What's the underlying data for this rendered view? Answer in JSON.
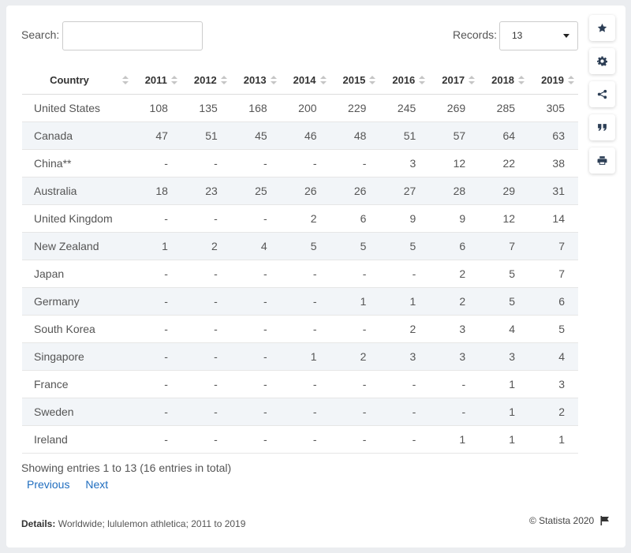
{
  "search": {
    "label": "Search:",
    "value": ""
  },
  "records": {
    "label": "Records:",
    "value": "13"
  },
  "toolbar": [
    {
      "icon": "star-icon"
    },
    {
      "icon": "gear-icon"
    },
    {
      "icon": "share-icon"
    },
    {
      "icon": "quote-icon"
    },
    {
      "icon": "print-icon"
    }
  ],
  "chart_data": {
    "type": "table",
    "columns": [
      "Country",
      "2011",
      "2012",
      "2013",
      "2014",
      "2015",
      "2016",
      "2017",
      "2018",
      "2019"
    ],
    "rows": [
      [
        "United States",
        "108",
        "135",
        "168",
        "200",
        "229",
        "245",
        "269",
        "285",
        "305"
      ],
      [
        "Canada",
        "47",
        "51",
        "45",
        "46",
        "48",
        "51",
        "57",
        "64",
        "63"
      ],
      [
        "China**",
        "-",
        "-",
        "-",
        "-",
        "-",
        "3",
        "12",
        "22",
        "38"
      ],
      [
        "Australia",
        "18",
        "23",
        "25",
        "26",
        "26",
        "27",
        "28",
        "29",
        "31"
      ],
      [
        "United Kingdom",
        "-",
        "-",
        "-",
        "2",
        "6",
        "9",
        "9",
        "12",
        "14"
      ],
      [
        "New Zealand",
        "1",
        "2",
        "4",
        "5",
        "5",
        "5",
        "6",
        "7",
        "7"
      ],
      [
        "Japan",
        "-",
        "-",
        "-",
        "-",
        "-",
        "-",
        "2",
        "5",
        "7"
      ],
      [
        "Germany",
        "-",
        "-",
        "-",
        "-",
        "1",
        "1",
        "2",
        "5",
        "6"
      ],
      [
        "South Korea",
        "-",
        "-",
        "-",
        "-",
        "-",
        "2",
        "3",
        "4",
        "5"
      ],
      [
        "Singapore",
        "-",
        "-",
        "-",
        "1",
        "2",
        "3",
        "3",
        "3",
        "4"
      ],
      [
        "France",
        "-",
        "-",
        "-",
        "-",
        "-",
        "-",
        "-",
        "1",
        "3"
      ],
      [
        "Sweden",
        "-",
        "-",
        "-",
        "-",
        "-",
        "-",
        "-",
        "1",
        "2"
      ],
      [
        "Ireland",
        "-",
        "-",
        "-",
        "-",
        "-",
        "-",
        "1",
        "1",
        "1"
      ]
    ]
  },
  "footer": {
    "entries_text": "Showing entries 1 to 13 (16 entries in total)",
    "previous_label": "Previous",
    "next_label": "Next",
    "details_label": "Details:",
    "details_text": "Worldwide; lululemon athletica; 2011 to 2019",
    "copyright": "© Statista 2020"
  },
  "colors": {
    "link": "#1f6dbf",
    "row_alt": "#f2f5f8"
  }
}
